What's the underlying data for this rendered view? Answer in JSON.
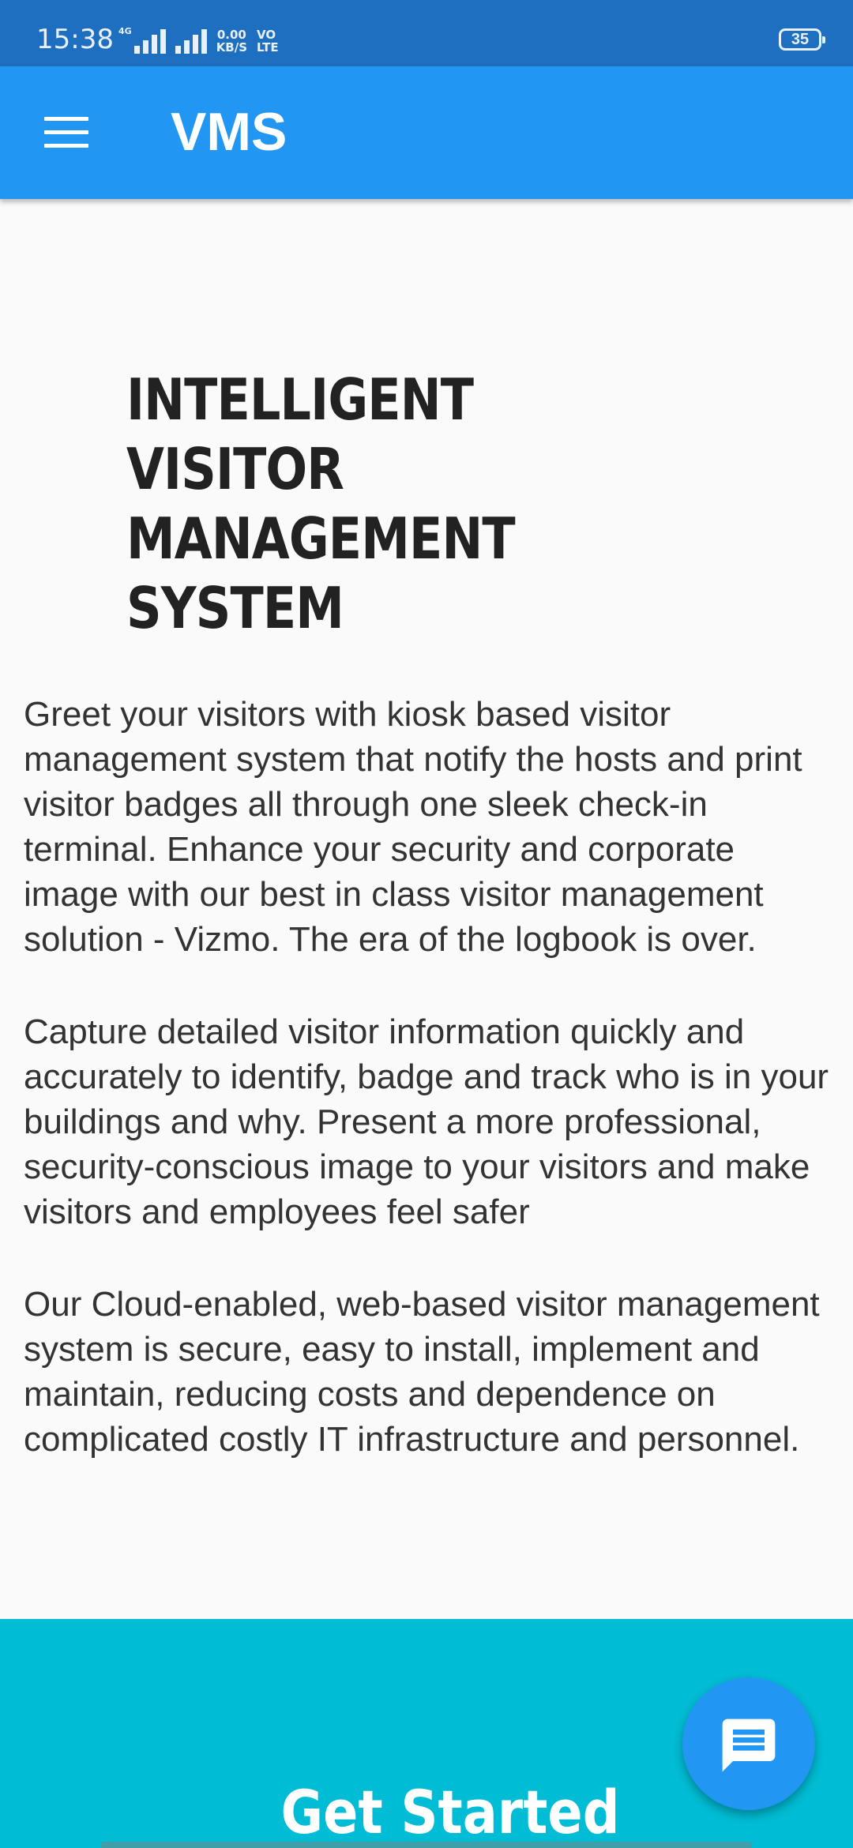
{
  "status_bar": {
    "time": "15:38",
    "network_type": "4G",
    "data_speed_value": "0.00",
    "data_speed_unit": "KB/S",
    "volte_top": "VO",
    "volte_bottom": "LTE",
    "battery_level": "35",
    "colors": {
      "background": "#1e6fc0",
      "foreground": "#e8f0fb"
    }
  },
  "app_bar": {
    "menu_icon": "hamburger-menu-icon",
    "title": "VMS",
    "color": "#2196f3"
  },
  "hero": {
    "heading": "INTELLIGENT VISITOR MANAGEMENT SYSTEM"
  },
  "content": {
    "paragraphs": [
      "Greet your visitors with kiosk based visitor management system that notify the hosts and print visitor badges all through one sleek check-in terminal. Enhance your security and corporate image with our best in class visitor management solution - Vizmo. The era of the logbook is over.",
      "Capture detailed visitor information quickly and accurately to identify, badge and track who is in your buildings and why. Present a more professional, security-conscious image to your visitors and make visitors and employees feel safer",
      "Our Cloud-enabled, web-based visitor management system is secure, easy to install, implement and maintain, reducing costs and dependence on complicated costly IT infrastructure and personnel."
    ]
  },
  "cta": {
    "title": "Get Started",
    "color": "#00bcd4"
  },
  "fab": {
    "icon": "chat-message-icon",
    "color": "#2196f3"
  }
}
